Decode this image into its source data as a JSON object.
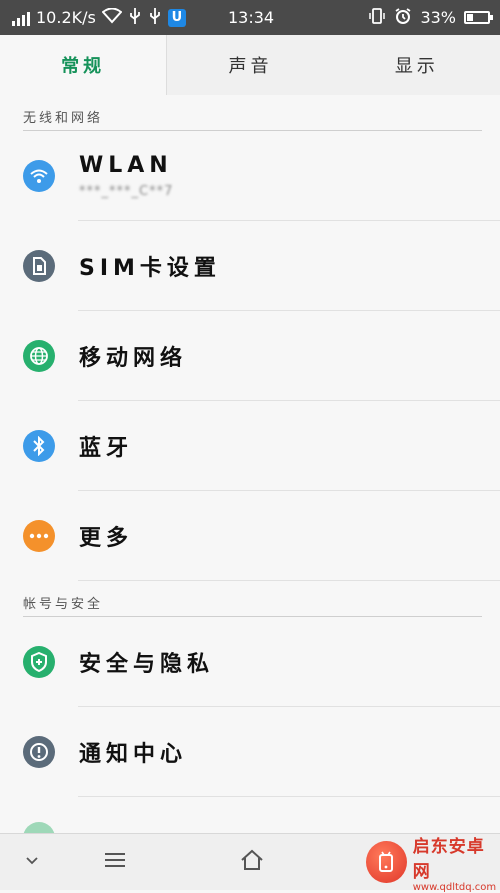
{
  "status_bar": {
    "net_speed": "10.2K/s",
    "time": "13:34",
    "battery": "33%",
    "battery_level": 0.33,
    "usb_badge": "U"
  },
  "tabs": [
    {
      "label": "常规",
      "active": true
    },
    {
      "label": "声音",
      "active": false
    },
    {
      "label": "显示",
      "active": false
    }
  ],
  "sections": [
    {
      "header": "无线和网络",
      "items": [
        {
          "label": "WLAN",
          "sublabel": "***_***_C**7",
          "icon": "wifi-icon",
          "color": "#3d9be9"
        },
        {
          "label": "SIM卡设置",
          "icon": "sim-card-icon",
          "color": "#5b6b7a"
        },
        {
          "label": "移动网络",
          "icon": "globe-icon",
          "color": "#27b06e"
        },
        {
          "label": "蓝牙",
          "icon": "bluetooth-icon",
          "color": "#3d9be9"
        },
        {
          "label": "更多",
          "icon": "more-dots-icon",
          "color": "#f4912b"
        }
      ]
    },
    {
      "header": "帐号与安全",
      "items": [
        {
          "label": "安全与隐私",
          "icon": "shield-icon",
          "color": "#27b06e"
        },
        {
          "label": "通知中心",
          "icon": "exclamation-icon",
          "color": "#5b6b7a"
        }
      ]
    }
  ],
  "watermark": {
    "title": "启东安卓网",
    "url": "www.qdltdq.com"
  }
}
